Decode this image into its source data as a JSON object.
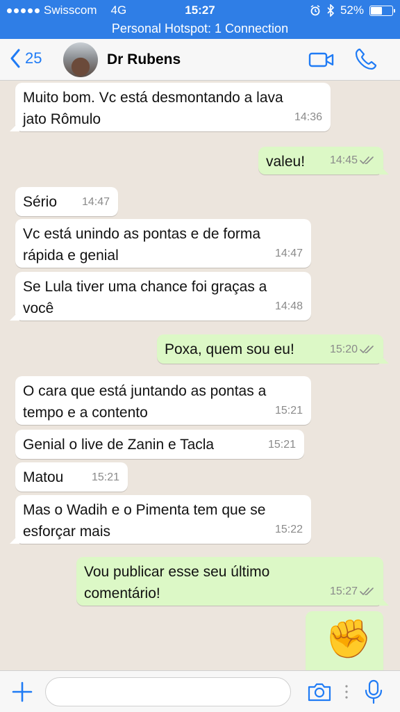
{
  "status": {
    "carrier": "Swisscom",
    "network": "4G",
    "time": "15:27",
    "battery": "52%",
    "battery_level": 0.52,
    "hotspot": "Personal Hotspot: 1 Connection"
  },
  "header": {
    "back_count": "25",
    "contact_name": "Dr Rubens"
  },
  "messages": [
    {
      "dir": "in",
      "text": "Muito bom. Vc está desmontando a lava\njato Rômulo",
      "time": "14:36"
    },
    {
      "dir": "out",
      "text": "valeu!",
      "time": "14:45"
    },
    {
      "dir": "in",
      "text": "Sério",
      "time": "14:47"
    },
    {
      "dir": "in",
      "text": "Vc está unindo as pontas e de forma\nrápida e genial",
      "time": "14:47"
    },
    {
      "dir": "in",
      "text": "Se Lula tiver uma chance foi graças a\nvocê",
      "time": "14:48"
    },
    {
      "dir": "out",
      "text": "Poxa, quem sou eu!",
      "time": "15:20"
    },
    {
      "dir": "in",
      "text": "O cara que está juntando as pontas a\ntempo e a contento",
      "time": "15:21"
    },
    {
      "dir": "in",
      "text": "Genial o live de Zanin e Tacla",
      "time": "15:21"
    },
    {
      "dir": "in",
      "text": "Matou",
      "time": "15:21"
    },
    {
      "dir": "in",
      "text": "Mas o Wadih e o Pimenta tem que se\nesforçar mais",
      "time": "15:22"
    },
    {
      "dir": "out",
      "text": "Vou publicar esse seu último\ncomentário!",
      "time": "15:27"
    },
    {
      "dir": "out",
      "emoji": "✊"
    }
  ],
  "input": {
    "placeholder": ""
  },
  "colors": {
    "status_bar": "#2f7ee6",
    "incoming_bubble": "#ffffff",
    "outgoing_bubble": "#dcf8c6",
    "accent": "#1f7bf5",
    "chat_background": "#ece5dd"
  }
}
